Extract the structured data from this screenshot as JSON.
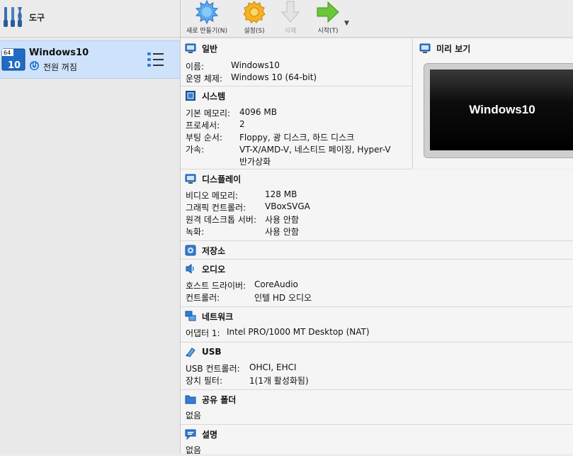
{
  "tools": {
    "label": "도구"
  },
  "vm": {
    "name": "Windows10",
    "state": "전원 꺼짐",
    "os_badge": "64",
    "os_version": "10"
  },
  "toolbar": {
    "new_label": "새로 만들기(N)",
    "settings_label": "설정(S)",
    "discard_label": "삭제",
    "start_label": "시작(T)",
    "start_dropdown": "▼"
  },
  "sections": {
    "general": {
      "title": "일반",
      "rows": [
        {
          "key": "이름:",
          "value": "Windows10"
        },
        {
          "key": "운영 체제:",
          "value": "Windows 10 (64-bit)"
        }
      ]
    },
    "system": {
      "title": "시스템",
      "rows": [
        {
          "key": "기본 메모리:",
          "value": "4096 MB"
        },
        {
          "key": "프로세서:",
          "value": "2"
        },
        {
          "key": "부팅 순서:",
          "value": "Floppy, 광 디스크, 하드 디스크"
        },
        {
          "key": "가속:",
          "value": "VT-X/AMD-V, 네스티드 페이징, Hyper-V"
        },
        {
          "key": "",
          "value": "반가상화"
        }
      ]
    },
    "display": {
      "title": "디스플레이",
      "rows": [
        {
          "key": "비디오 메모리:",
          "value": "128 MB"
        },
        {
          "key": "그래픽 컨트롤러:",
          "value": "VBoxSVGA"
        },
        {
          "key": "원격 데스크톱 서버:",
          "value": "사용 안함"
        },
        {
          "key": "녹화:",
          "value": "사용 안함"
        }
      ]
    },
    "storage": {
      "title": "저장소"
    },
    "audio": {
      "title": "오디오",
      "rows": [
        {
          "key": "호스트 드라이버:",
          "value": "CoreAudio"
        },
        {
          "key": "컨트롤러:",
          "value": "인텔 HD 오디오"
        }
      ]
    },
    "network": {
      "title": "네트워크",
      "rows": [
        {
          "key": "어댑터 1:",
          "value": "Intel PRO/1000 MT Desktop (NAT)"
        }
      ]
    },
    "usb": {
      "title": "USB",
      "rows": [
        {
          "key": "USB 컨트롤러:",
          "value": "OHCI, EHCI"
        },
        {
          "key": "장치 필터:",
          "value": "1(1개 활성화됨)"
        }
      ]
    },
    "shared": {
      "title": "공유 폴더",
      "text": "없음"
    },
    "description": {
      "title": "설명",
      "text": "없음"
    }
  },
  "preview": {
    "title": "미리 보기",
    "screen_text": "Windows10"
  },
  "colors": {
    "selection": "#cfe2fb",
    "accent_blue": "#2f7fd8",
    "section_bg": "#f5f5f5"
  }
}
